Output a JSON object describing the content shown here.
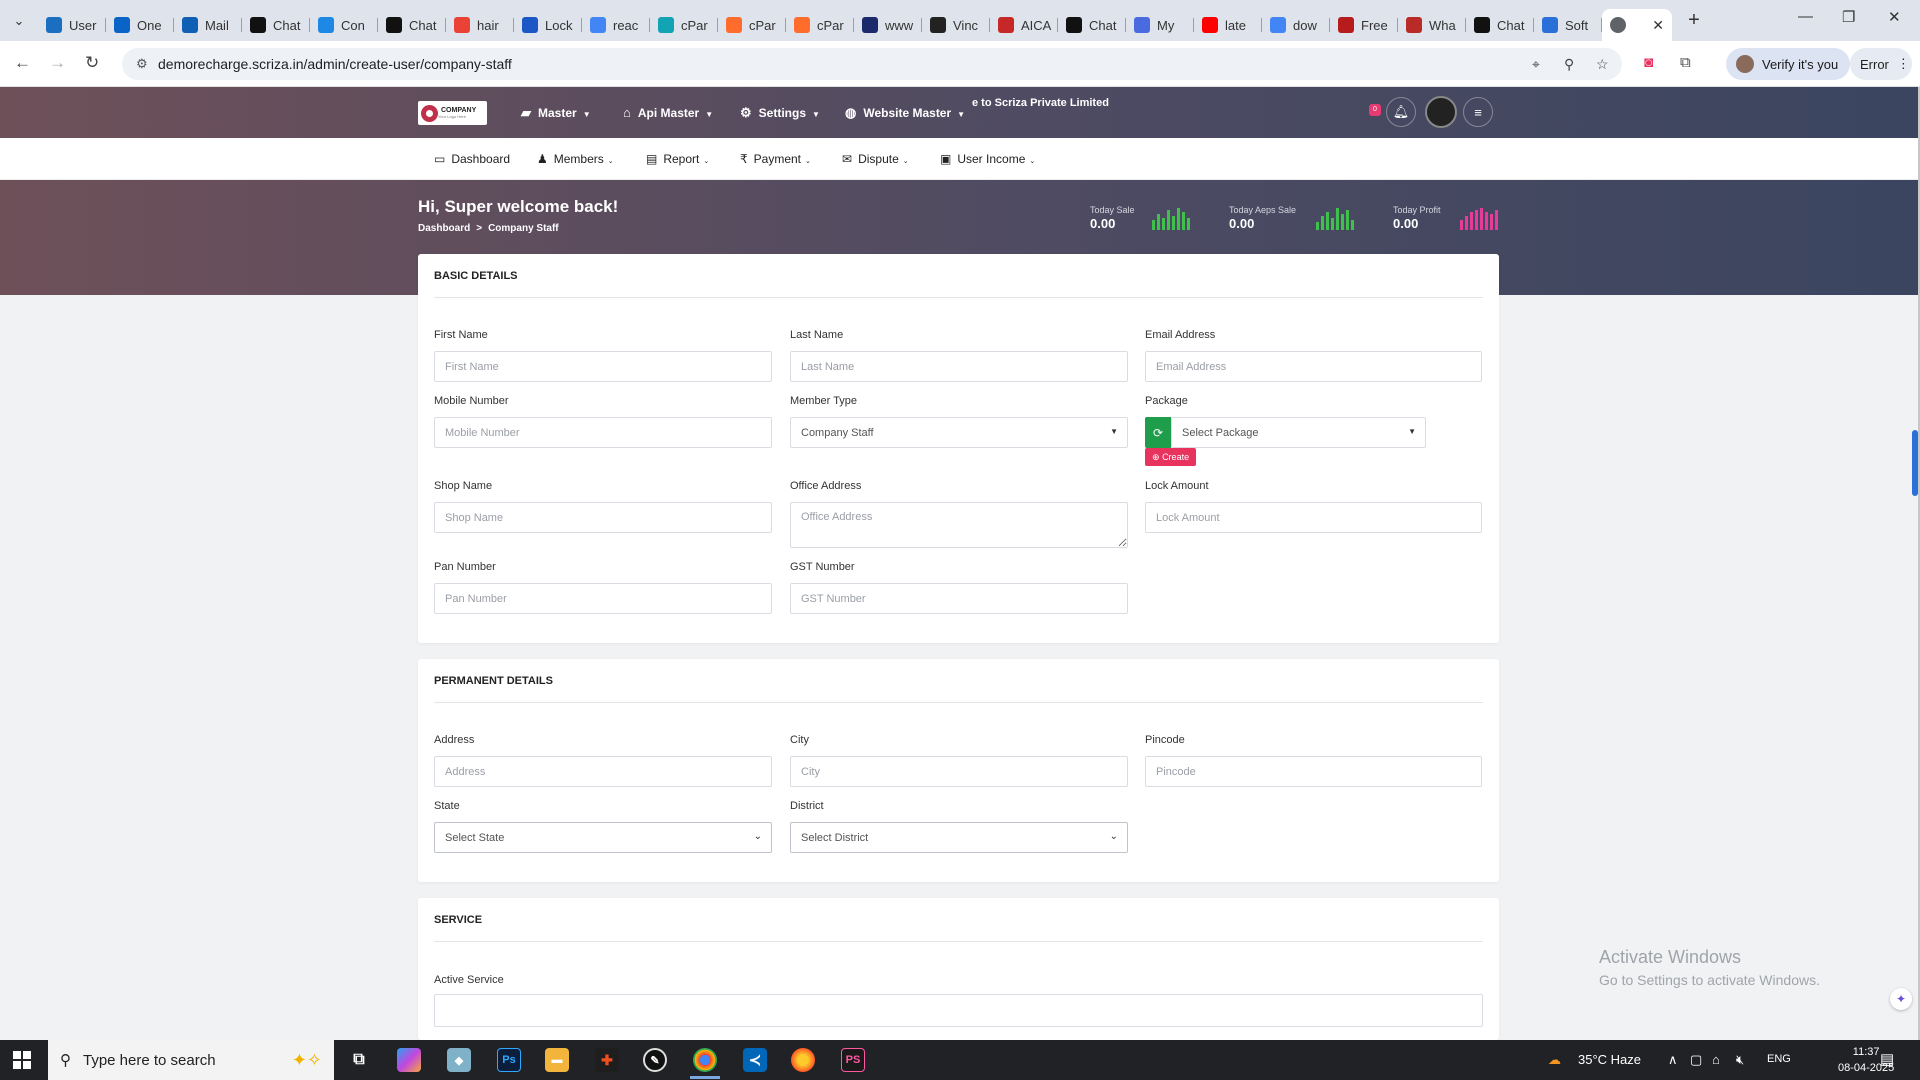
{
  "browser": {
    "tabs": [
      {
        "label": "User",
        "color": "#1a6fc0"
      },
      {
        "label": "One",
        "color": "#0a64c8"
      },
      {
        "label": "Mail",
        "color": "#0f5fb5"
      },
      {
        "label": "Chat",
        "color": "#111111"
      },
      {
        "label": "Con",
        "color": "#1e88e5"
      },
      {
        "label": "Chat",
        "color": "#111111"
      },
      {
        "label": "hair",
        "color": "#ea4335"
      },
      {
        "label": "Lock",
        "color": "#1b57c5"
      },
      {
        "label": "reac",
        "color": "#4285f4"
      },
      {
        "label": "cPar",
        "color": "#12a3b5"
      },
      {
        "label": "cPar",
        "color": "#ff6c2c"
      },
      {
        "label": "cPar",
        "color": "#ff6c2c"
      },
      {
        "label": "www",
        "color": "#1b2a6b"
      },
      {
        "label": "Vinc",
        "color": "#222222"
      },
      {
        "label": "AICA",
        "color": "#c62828"
      },
      {
        "label": "Chat",
        "color": "#111111"
      },
      {
        "label": "My",
        "color": "#4a6ae0"
      },
      {
        "label": "late",
        "color": "#ff0000"
      },
      {
        "label": "dow",
        "color": "#4285f4"
      },
      {
        "label": "Free",
        "color": "#b71c1c"
      },
      {
        "label": "Wha",
        "color": "#b92b27"
      },
      {
        "label": "Chat",
        "color": "#111111"
      },
      {
        "label": "Soft",
        "color": "#2b6fd9"
      }
    ],
    "url": "demorecharge.scriza.in/admin/create-user/company-staff",
    "verify_label": "Verify it's you",
    "error_label": "Error"
  },
  "header": {
    "logo_text": "COMPANY",
    "logo_tag": "Your Logo Here",
    "nav": [
      {
        "label": "Master",
        "icon": "map-icon",
        "glyph": "▰"
      },
      {
        "label": "Api Master",
        "icon": "bank-icon",
        "glyph": "⌂"
      },
      {
        "label": "Settings",
        "icon": "gear-icon",
        "glyph": "⚙"
      },
      {
        "label": "Website Master",
        "icon": "globe-icon",
        "glyph": "◍"
      }
    ],
    "marquee": "e to Scriza Private Limited",
    "notification_count": "0"
  },
  "subnav": [
    {
      "label": "Dashboard",
      "icon": "monitor-icon",
      "glyph": "▭",
      "dropdown": false
    },
    {
      "label": "Members",
      "icon": "users-icon",
      "glyph": "♟",
      "dropdown": true
    },
    {
      "label": "Report",
      "icon": "table-icon",
      "glyph": "▤",
      "dropdown": true
    },
    {
      "label": "Payment",
      "icon": "rupee-icon",
      "glyph": "₹",
      "dropdown": true
    },
    {
      "label": "Dispute",
      "icon": "comments-icon",
      "glyph": "✉",
      "dropdown": true
    },
    {
      "label": "User Income",
      "icon": "money-icon",
      "glyph": "▣",
      "dropdown": true
    }
  ],
  "banner": {
    "greeting": "Hi, Super welcome back!",
    "breadcrumb": [
      "Dashboard",
      "Company Staff"
    ],
    "stats": [
      {
        "label": "Today Sale",
        "value": "0.00",
        "color": "#3ec14a"
      },
      {
        "label": "Today Aeps Sale",
        "value": "0.00",
        "color": "#3ec14a"
      },
      {
        "label": "Today Profit",
        "value": "0.00",
        "color": "#e83a9a"
      }
    ]
  },
  "basic": {
    "title": "BASIC DETAILS",
    "first_name": {
      "label": "First Name",
      "placeholder": "First Name"
    },
    "last_name": {
      "label": "Last Name",
      "placeholder": "Last Name"
    },
    "email": {
      "label": "Email Address",
      "placeholder": "Email Address"
    },
    "mobile": {
      "label": "Mobile Number",
      "placeholder": "Mobile Number"
    },
    "member_type": {
      "label": "Member Type",
      "value": "Company Staff"
    },
    "package": {
      "label": "Package",
      "value": "Select Package",
      "create_label": "Create"
    },
    "shop": {
      "label": "Shop Name",
      "placeholder": "Shop Name"
    },
    "office": {
      "label": "Office Address",
      "placeholder": "Office Address"
    },
    "lock": {
      "label": "Lock Amount",
      "placeholder": "Lock Amount"
    },
    "pan": {
      "label": "Pan Number",
      "placeholder": "Pan Number"
    },
    "gst": {
      "label": "GST Number",
      "placeholder": "GST Number"
    }
  },
  "permanent": {
    "title": "PERMANENT DETAILS",
    "address": {
      "label": "Address",
      "placeholder": "Address"
    },
    "city": {
      "label": "City",
      "placeholder": "City"
    },
    "pincode": {
      "label": "Pincode",
      "placeholder": "Pincode"
    },
    "state": {
      "label": "State",
      "value": "Select State"
    },
    "district": {
      "label": "District",
      "value": "Select District"
    }
  },
  "service": {
    "title": "SERVICE",
    "active_label": "Active Service"
  },
  "watermark": {
    "line1": "Activate Windows",
    "line2": "Go to Settings to activate Windows."
  },
  "taskbar": {
    "search_placeholder": "Type here to search",
    "weather": "35°C  Haze",
    "lang": "ENG",
    "time": "11:37",
    "date": "08-04-2025"
  }
}
